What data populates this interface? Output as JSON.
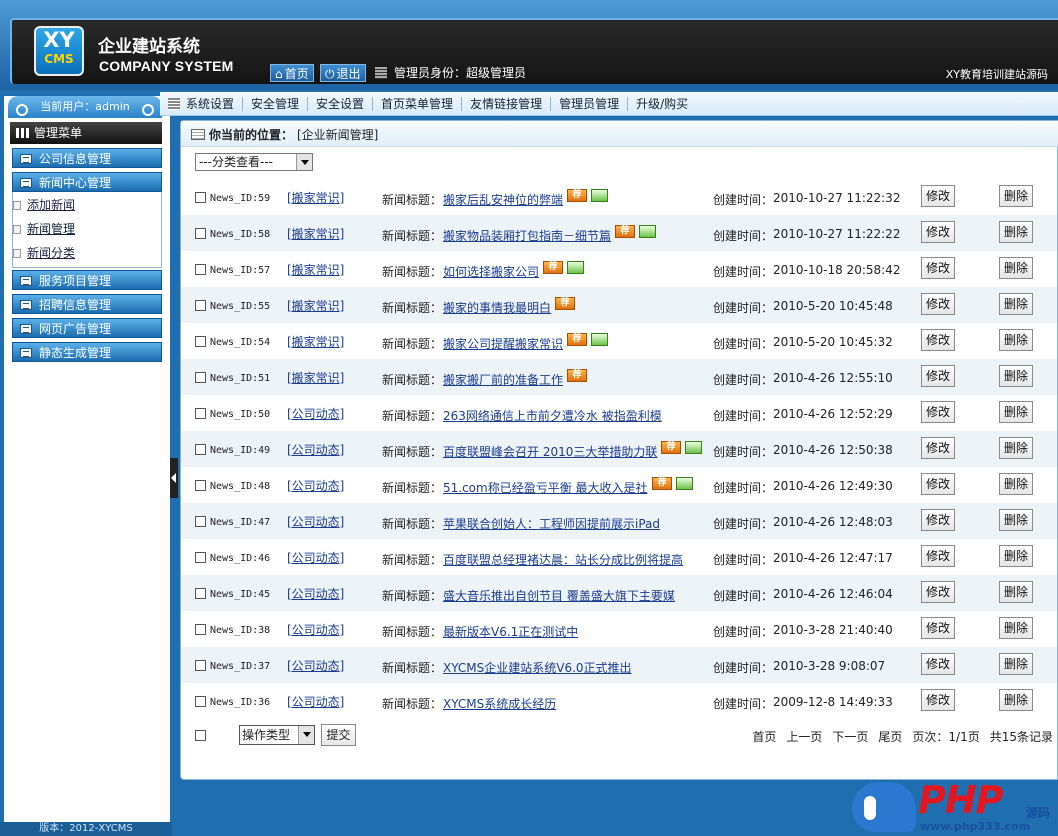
{
  "header": {
    "logo_top": "XY",
    "logo_bottom": "CMS",
    "title_cn": "企业建站系统",
    "title_en": "COMPANY SYSTEM",
    "home_label": "首页",
    "logout_label": "退出",
    "admin_identity": "管理员身份：超级管理员",
    "site_name": "XY教育培训建站源码"
  },
  "sidebar": {
    "current_user": "当前用户：admin",
    "menu_title": "管理菜单",
    "categories": [
      {
        "label": "公司信息管理"
      },
      {
        "label": "新闻中心管理"
      },
      {
        "label": "服务项目管理"
      },
      {
        "label": "招聘信息管理"
      },
      {
        "label": "网页广告管理"
      },
      {
        "label": "静态生成管理"
      }
    ],
    "subitems": [
      {
        "label": "添加新闻"
      },
      {
        "label": "新闻管理"
      },
      {
        "label": "新闻分类"
      }
    ],
    "version": "版本：2012-XYCMS"
  },
  "topnav": {
    "items": [
      "系统设置",
      "安全管理",
      "安全设置",
      "首页菜单管理",
      "友情链接管理",
      "管理员管理",
      "升级/购买"
    ]
  },
  "main": {
    "location_label": "你当前的位置：",
    "location_value": "[企业新闻管理]",
    "category_select": "---分类查看---",
    "title_label": "新闻标题：",
    "created_label": "创建时间：",
    "edit_label": "修改",
    "delete_label": "删除",
    "rec_badge": "荐",
    "rows": [
      {
        "id": "News_ID:59",
        "category": "[搬家常识]",
        "title": "搬家后乱安神位的弊端",
        "rec": true,
        "pic": true,
        "time": "2010-10-27 11:22:32"
      },
      {
        "id": "News_ID:58",
        "category": "[搬家常识]",
        "title": "搬家物品装厢打包指南－细节篇",
        "rec": true,
        "pic": true,
        "time": "2010-10-27 11:22:22"
      },
      {
        "id": "News_ID:57",
        "category": "[搬家常识]",
        "title": "如何选择搬家公司",
        "rec": true,
        "pic": true,
        "time": "2010-10-18 20:58:42"
      },
      {
        "id": "News_ID:55",
        "category": "[搬家常识]",
        "title": "搬家的事情我最明白",
        "rec": true,
        "pic": false,
        "time": "2010-5-20 10:45:48"
      },
      {
        "id": "News_ID:54",
        "category": "[搬家常识]",
        "title": "搬家公司提醒搬家常识",
        "rec": true,
        "pic": true,
        "time": "2010-5-20 10:45:32"
      },
      {
        "id": "News_ID:51",
        "category": "[搬家常识]",
        "title": "搬家搬厂前的准备工作",
        "rec": true,
        "pic": false,
        "time": "2010-4-26 12:55:10"
      },
      {
        "id": "News_ID:50",
        "category": "[公司动态]",
        "title": "263网络通信上市前夕遭冷水 被指盈利模",
        "rec": false,
        "pic": false,
        "time": "2010-4-26 12:52:29"
      },
      {
        "id": "News_ID:49",
        "category": "[公司动态]",
        "title": "百度联盟峰会召开 2010三大举措助力联",
        "rec": true,
        "pic": true,
        "time": "2010-4-26 12:50:38"
      },
      {
        "id": "News_ID:48",
        "category": "[公司动态]",
        "title": "51.com称已经盈亏平衡 最大收入是社",
        "rec": true,
        "pic": true,
        "time": "2010-4-26 12:49:30"
      },
      {
        "id": "News_ID:47",
        "category": "[公司动态]",
        "title": "苹果联合创始人：工程师因提前展示iPad",
        "rec": false,
        "pic": false,
        "time": "2010-4-26 12:48:03"
      },
      {
        "id": "News_ID:46",
        "category": "[公司动态]",
        "title": "百度联盟总经理褚达晨：站长分成比例将提高",
        "rec": false,
        "pic": false,
        "time": "2010-4-26 12:47:17"
      },
      {
        "id": "News_ID:45",
        "category": "[公司动态]",
        "title": "盛大音乐推出自创节目 覆盖盛大旗下主要媒",
        "rec": false,
        "pic": false,
        "time": "2010-4-26 12:46:04"
      },
      {
        "id": "News_ID:38",
        "category": "[公司动态]",
        "title": "最新版本V6.1正在测试中",
        "rec": false,
        "pic": false,
        "time": "2010-3-28 21:40:40"
      },
      {
        "id": "News_ID:37",
        "category": "[公司动态]",
        "title": "XYCMS企业建站系统V6.0正式推出",
        "rec": false,
        "pic": false,
        "time": "2010-3-28 9:08:07"
      },
      {
        "id": "News_ID:36",
        "category": "[公司动态]",
        "title": "XYCMS系统成长经历",
        "rec": false,
        "pic": false,
        "time": "2009-12-8 14:49:33"
      }
    ],
    "op_select": "操作类型",
    "submit_label": "提交",
    "pager": {
      "first": "首页",
      "prev": "上一页",
      "next": "下一页",
      "last": "尾页",
      "pages": "页次：1/1页",
      "total": "共15条记录"
    }
  },
  "watermark": {
    "php": "PHP",
    "source": "源码",
    "url": "www.php333.com"
  }
}
